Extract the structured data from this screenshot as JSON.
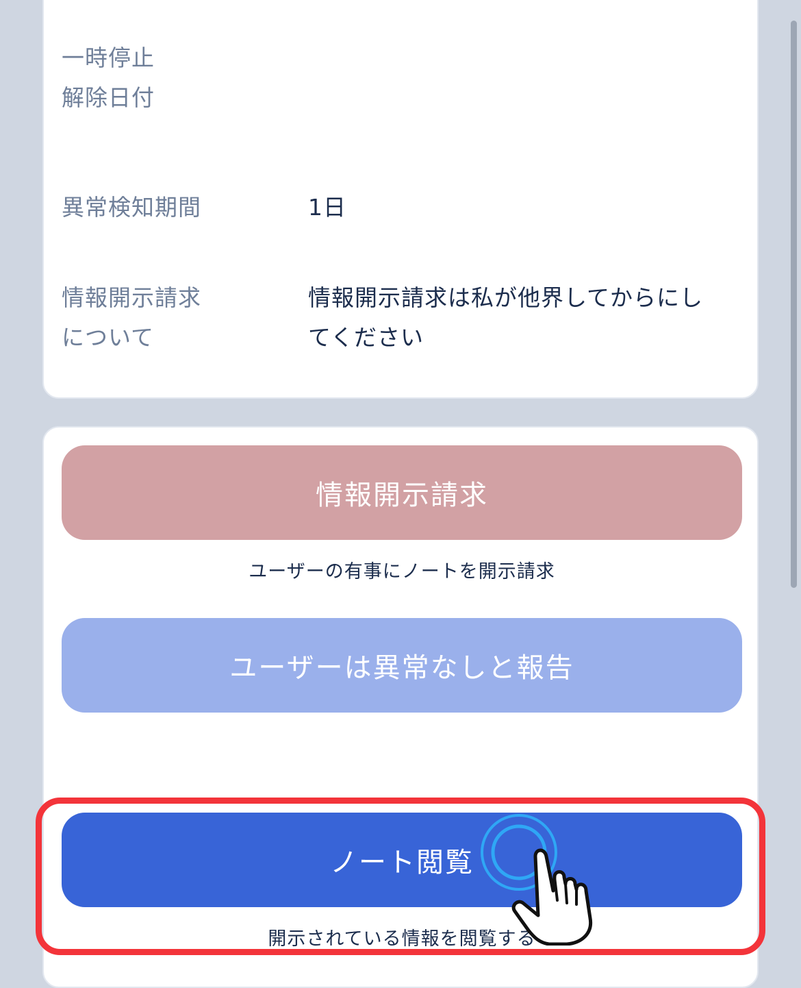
{
  "info": {
    "pause_release": {
      "label_line1": "一時停止",
      "label_line2": "解除日付",
      "value": ""
    },
    "detection_period": {
      "label": "異常検知期間",
      "value": "1日"
    },
    "disclosure_note": {
      "label_line1": "情報開示請求",
      "label_line2": "について",
      "value_line1": "情報開示請求は私が他界してからにし",
      "value_line2": "てください"
    }
  },
  "actions": {
    "disclosure_request": {
      "label": "情報開示請求",
      "caption": "ユーザーの有事にノートを開示請求",
      "color": "#d2a1a4"
    },
    "report_normal": {
      "label": "ユーザーは異常なしと報告",
      "color": "#9ab0eb"
    },
    "view_note": {
      "label": "ノート閲覧",
      "caption": "開示されている情報を閲覧する",
      "color": "#3864d7"
    }
  },
  "highlight_color": "#f3343a",
  "tap_indicator_icon": "hand-pointer-icon"
}
